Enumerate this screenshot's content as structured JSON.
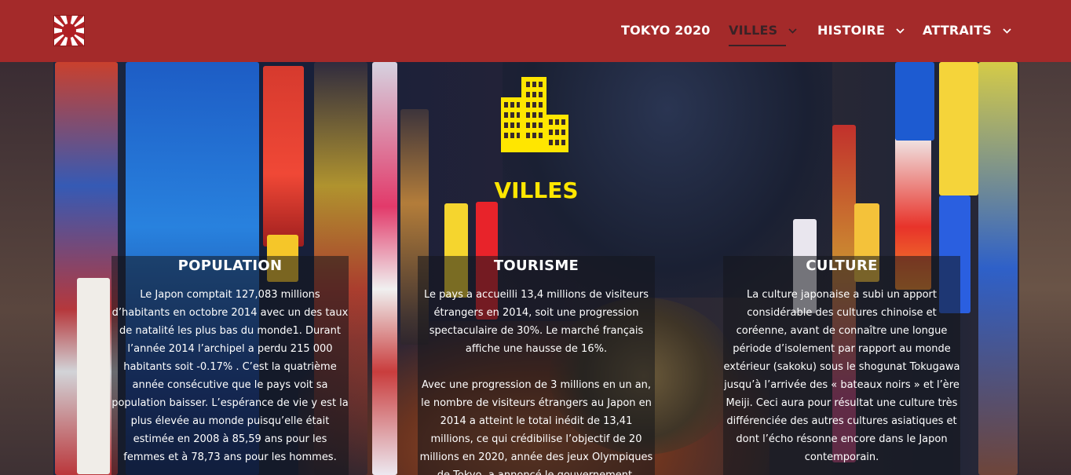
{
  "header": {
    "nav": [
      {
        "label": "TOKYO 2020",
        "has_dropdown": false,
        "active": false
      },
      {
        "label": "VILLES",
        "has_dropdown": true,
        "active": true
      },
      {
        "label": "HISTOIRE",
        "has_dropdown": true,
        "active": false
      },
      {
        "label": "ATTRAITS",
        "has_dropdown": true,
        "active": false
      }
    ],
    "logo_icon": "rising-sun-icon",
    "chevron_icon": "chevron-down-icon"
  },
  "hero": {
    "icon": "buildings-icon",
    "title": "VILLES"
  },
  "columns": [
    {
      "title": "POPULATION",
      "paragraphs": [
        "Le Japon comptait 127,083 millions d’habitants en octobre 2014 avec un des taux de natalité les plus bas du monde1. Durant l’année 2014 l’archipel a perdu 215 000 habitants soit -0.17% . C’est la quatrième année consécutive que le pays voit sa population baisser. L’espérance de vie y est la plus élevée au monde puisqu’elle était estimée en 2008 à 85,59 ans pour les femmes et à 78,73 ans pour les hommes."
      ]
    },
    {
      "title": "TOURISME",
      "paragraphs": [
        "Le pays a accueilli 13,4 millions de visiteurs étrangers en 2014, soit une progression spectaculaire de 30%. Le marché français affiche une hausse de 16%.",
        "Avec une progression de 3 millions en un an, le nombre de visiteurs étrangers au Japon en 2014 a atteint le total inédit de 13,41 millions, ce qui crédibilise l’objectif de 20 millions en 2020, année des jeux Olympiques de Tokyo, a annoncé le gouvernement."
      ]
    },
    {
      "title": "CULTURE",
      "paragraphs": [
        "La culture japonaise a subi un apport considérable des cultures chinoise et coréenne, avant de connaître une longue période d’isolement par rapport au monde extérieur (sakoku) sous le shogunat Tokugawa jusqu’à l’arrivée des « bateaux noirs » et l’ère Meiji. Ceci aura pour résultat une culture très différenciée des autres cultures asiatiques et dont l’écho résonne encore dans le Japon contemporain."
      ]
    }
  ],
  "colors": {
    "header_bg": "#a42a2a",
    "title_yellow": "#ffe600",
    "nav_active": "#3a2226"
  }
}
